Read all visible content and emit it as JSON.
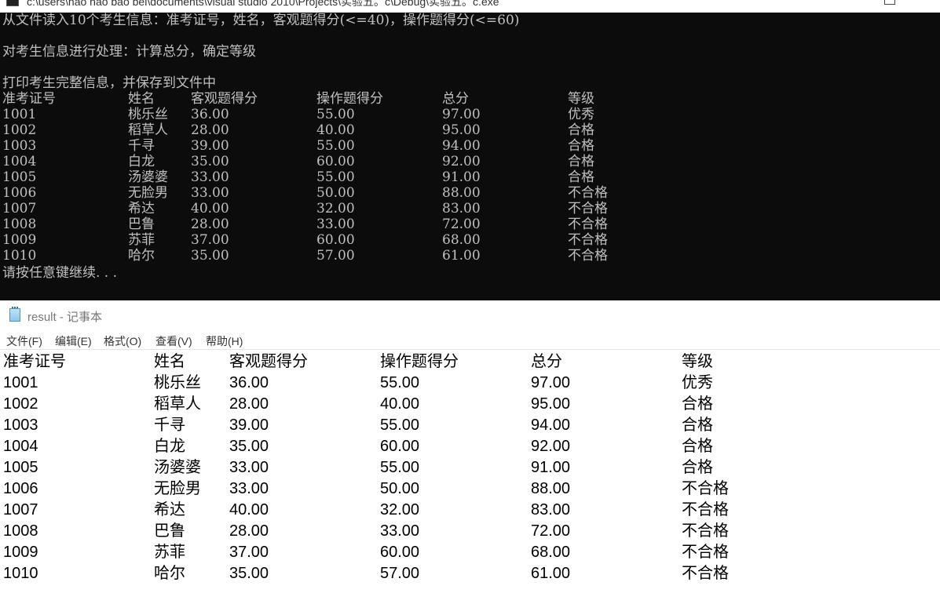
{
  "console": {
    "title": "c:\\users\\hao hao bao bei\\documents\\visual studio 2010\\Projects\\实验五。c\\Debug\\实验五。c.exe",
    "lines": {
      "read": "从文件读入10个考生信息：准考证号，姓名，客观题得分(<=40)，操作题得分(<=60)",
      "process": "对考生信息进行处理：计算总分，确定等级",
      "print": "打印考生完整信息，并保存到文件中",
      "continue": "请按任意键继续. . ."
    },
    "headers": [
      "准考证号",
      "姓名",
      "客观题得分",
      "操作题得分",
      "总分",
      "等级"
    ],
    "rows": [
      [
        "1001",
        "桃乐丝",
        "36.00",
        "55.00",
        "97.00",
        "优秀"
      ],
      [
        "1002",
        "稻草人",
        "28.00",
        "40.00",
        "95.00",
        "合格"
      ],
      [
        "1003",
        "千寻",
        "39.00",
        "55.00",
        "94.00",
        "合格"
      ],
      [
        "1004",
        "白龙",
        "35.00",
        "60.00",
        "92.00",
        "合格"
      ],
      [
        "1005",
        "汤婆婆",
        "33.00",
        "55.00",
        "91.00",
        "合格"
      ],
      [
        "1006",
        "无脸男",
        "33.00",
        "50.00",
        "88.00",
        "不合格"
      ],
      [
        "1007",
        "希达",
        "40.00",
        "32.00",
        "83.00",
        "不合格"
      ],
      [
        "1008",
        "巴鲁",
        "28.00",
        "33.00",
        "72.00",
        "不合格"
      ],
      [
        "1009",
        "苏菲",
        "37.00",
        "60.00",
        "68.00",
        "不合格"
      ],
      [
        "1010",
        "哈尔",
        "35.00",
        "57.00",
        "61.00",
        "不合格"
      ]
    ]
  },
  "notepad": {
    "title": "result - 记事本",
    "menu": [
      "文件(F)",
      "编辑(E)",
      "格式(O)",
      "查看(V)",
      "帮助(H)"
    ],
    "headers": [
      "准考证号",
      "姓名",
      "客观题得分",
      "操作题得分",
      "总分",
      "等级"
    ],
    "rows": [
      [
        "1001",
        "桃乐丝",
        "36.00",
        "55.00",
        "97.00",
        "优秀"
      ],
      [
        "1002",
        "稻草人",
        "28.00",
        "40.00",
        "95.00",
        "合格"
      ],
      [
        "1003",
        "千寻",
        "39.00",
        "55.00",
        "94.00",
        "合格"
      ],
      [
        "1004",
        "白龙",
        "35.00",
        "60.00",
        "92.00",
        "合格"
      ],
      [
        "1005",
        "汤婆婆",
        "33.00",
        "55.00",
        "91.00",
        "合格"
      ],
      [
        "1006",
        "无脸男",
        "33.00",
        "50.00",
        "88.00",
        "不合格"
      ],
      [
        "1007",
        "希达",
        "40.00",
        "32.00",
        "83.00",
        "不合格"
      ],
      [
        "1008",
        "巴鲁",
        "28.00",
        "33.00",
        "72.00",
        "不合格"
      ],
      [
        "1009",
        "苏菲",
        "37.00",
        "60.00",
        "68.00",
        "不合格"
      ],
      [
        "1010",
        "哈尔",
        "35.00",
        "57.00",
        "61.00",
        "不合格"
      ]
    ]
  }
}
